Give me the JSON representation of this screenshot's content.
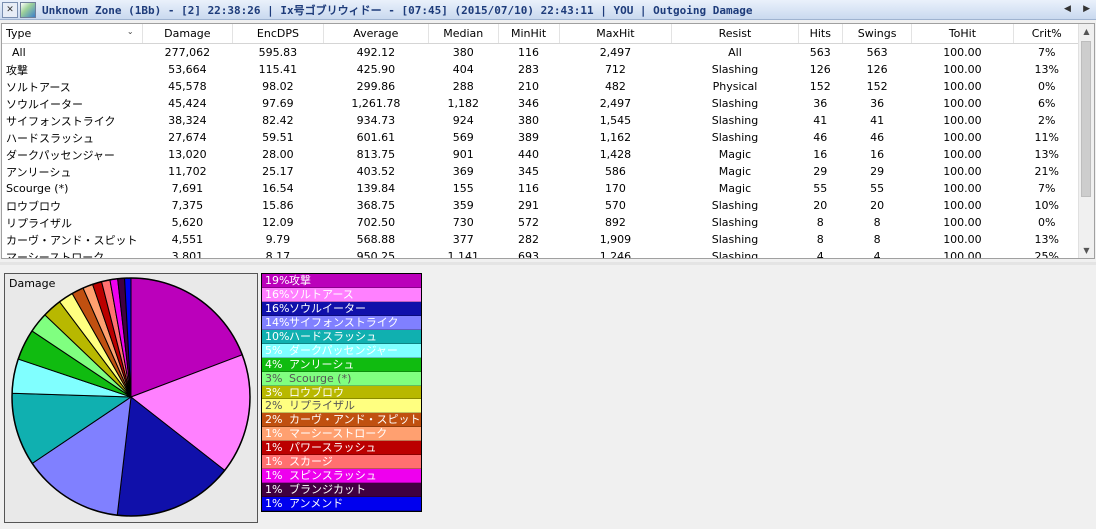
{
  "title": "Unknown Zone (1Bb) - [2] 22:38:26 | Ix号ゴブリウィドー - [07:45] (2015/07/10) 22:43:11 | YOU | Outgoing Damage",
  "table": {
    "columns": [
      "Type",
      "Damage",
      "EncDPS",
      "Average",
      "Median",
      "MinHit",
      "MaxHit",
      "Resist",
      "Hits",
      "Swings",
      "ToHit",
      "Crit%"
    ],
    "rows": [
      [
        "All",
        "277,062",
        "595.83",
        "492.12",
        "380",
        "116",
        "2,497",
        "All",
        "563",
        "563",
        "100.00",
        "7%"
      ],
      [
        "攻撃",
        "53,664",
        "115.41",
        "425.90",
        "404",
        "283",
        "712",
        "Slashing",
        "126",
        "126",
        "100.00",
        "13%"
      ],
      [
        "ソルトアース",
        "45,578",
        "98.02",
        "299.86",
        "288",
        "210",
        "482",
        "Physical",
        "152",
        "152",
        "100.00",
        "0%"
      ],
      [
        "ソウルイーター",
        "45,424",
        "97.69",
        "1,261.78",
        "1,182",
        "346",
        "2,497",
        "Slashing",
        "36",
        "36",
        "100.00",
        "6%"
      ],
      [
        "サイフォンストライク",
        "38,324",
        "82.42",
        "934.73",
        "924",
        "380",
        "1,545",
        "Slashing",
        "41",
        "41",
        "100.00",
        "2%"
      ],
      [
        "ハードスラッシュ",
        "27,674",
        "59.51",
        "601.61",
        "569",
        "389",
        "1,162",
        "Slashing",
        "46",
        "46",
        "100.00",
        "11%"
      ],
      [
        "ダークパッセンジャー",
        "13,020",
        "28.00",
        "813.75",
        "901",
        "440",
        "1,428",
        "Magic",
        "16",
        "16",
        "100.00",
        "13%"
      ],
      [
        "アンリーシュ",
        "11,702",
        "25.17",
        "403.52",
        "369",
        "345",
        "586",
        "Magic",
        "29",
        "29",
        "100.00",
        "21%"
      ],
      [
        "Scourge (*)",
        "7,691",
        "16.54",
        "139.84",
        "155",
        "116",
        "170",
        "Magic",
        "55",
        "55",
        "100.00",
        "7%"
      ],
      [
        "ロウブロウ",
        "7,375",
        "15.86",
        "368.75",
        "359",
        "291",
        "570",
        "Slashing",
        "20",
        "20",
        "100.00",
        "10%"
      ],
      [
        "リプライザル",
        "5,620",
        "12.09",
        "702.50",
        "730",
        "572",
        "892",
        "Slashing",
        "8",
        "8",
        "100.00",
        "0%"
      ],
      [
        "カーヴ・アンド・スピット",
        "4,551",
        "9.79",
        "568.88",
        "377",
        "282",
        "1,909",
        "Slashing",
        "8",
        "8",
        "100.00",
        "13%"
      ],
      [
        "マーシーストローク",
        "3,801",
        "8.17",
        "950.25",
        "1,141",
        "693",
        "1,246",
        "Slashing",
        "4",
        "4",
        "100.00",
        "25%"
      ]
    ]
  },
  "pie": {
    "label": "Damage",
    "slices": [
      {
        "pct": "19%",
        "name": "攻撃",
        "value": 53664,
        "color": "#bb00bb",
        "text": "#ffffff"
      },
      {
        "pct": "16%",
        "name": "ソルトアース",
        "value": 45578,
        "color": "#ff80ff",
        "text": "#ffffff"
      },
      {
        "pct": "16%",
        "name": "ソウルイーター",
        "value": 45424,
        "color": "#1010aa",
        "text": "#ffffff"
      },
      {
        "pct": "14%",
        "name": "サイフォンストライク",
        "value": 38324,
        "color": "#8080ff",
        "text": "#ffffff"
      },
      {
        "pct": "10%",
        "name": "ハードスラッシュ",
        "value": 27674,
        "color": "#10b0b0",
        "text": "#ffffff"
      },
      {
        "pct": "5%",
        "name": "ダークパッセンジャー",
        "value": 13020,
        "color": "#80ffff",
        "text": "#ffffff"
      },
      {
        "pct": "4%",
        "name": "アンリーシュ",
        "value": 11702,
        "color": "#10bb10",
        "text": "#ffffff"
      },
      {
        "pct": "3%",
        "name": "Scourge (*)",
        "value": 7691,
        "color": "#80ff80",
        "text": "#555555"
      },
      {
        "pct": "3%",
        "name": "ロウブロウ",
        "value": 7375,
        "color": "#b8b800",
        "text": "#ffffff"
      },
      {
        "pct": "2%",
        "name": "リプライザル",
        "value": 5620,
        "color": "#ffff80",
        "text": "#555555"
      },
      {
        "pct": "2%",
        "name": "カーヴ・アンド・スピット",
        "value": 4551,
        "color": "#c05010",
        "text": "#ffffff"
      },
      {
        "pct": "1%",
        "name": "マーシーストローク",
        "value": 3801,
        "color": "#ffa070",
        "text": "#ffffff"
      },
      {
        "pct": "1%",
        "name": "パワースラッシュ",
        "value": 3500,
        "color": "#bb0000",
        "text": "#ffffff"
      },
      {
        "pct": "1%",
        "name": "スカージ",
        "value": 3200,
        "color": "#ff7070",
        "text": "#ffffff"
      },
      {
        "pct": "1%",
        "name": "スピンスラッシュ",
        "value": 2900,
        "color": "#ee00ee",
        "text": "#ffffff"
      },
      {
        "pct": "1%",
        "name": "ブランジカット",
        "value": 2600,
        "color": "#400040",
        "text": "#ffffff"
      },
      {
        "pct": "1%",
        "name": "アンメンド",
        "value": 2400,
        "color": "#0000ee",
        "text": "#ffffff"
      }
    ]
  }
}
